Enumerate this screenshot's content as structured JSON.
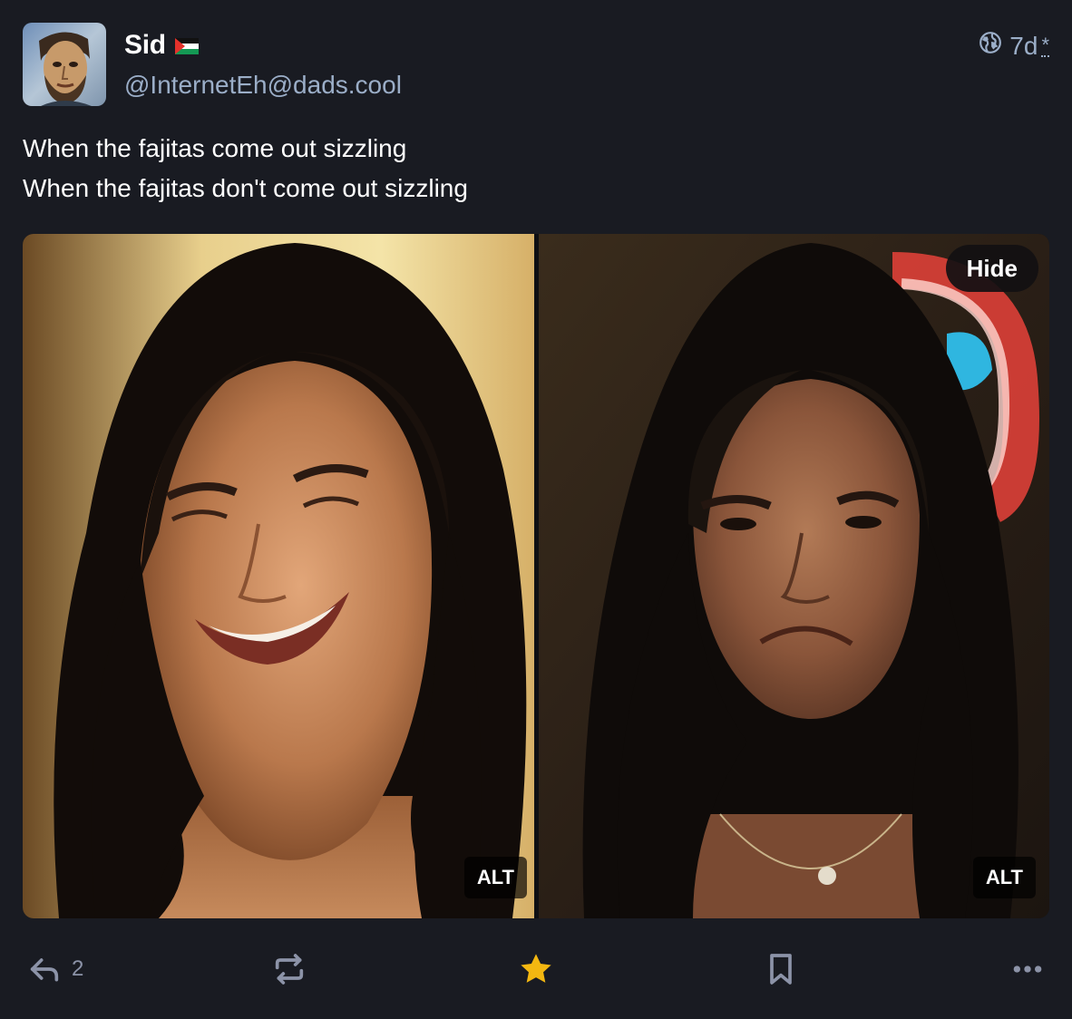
{
  "account": {
    "display_name": "Sid",
    "handle": "@InternetEh@dads.cool"
  },
  "post": {
    "timestamp": "7d",
    "edited_mark": "*",
    "lines": [
      "When the fajitas come out sizzling",
      "When the fajitas don't come out sizzling"
    ]
  },
  "media": {
    "alt_label_left": "ALT",
    "alt_label_right": "ALT",
    "hide_label": "Hide"
  },
  "actions": {
    "reply_count": "2"
  },
  "colors": {
    "background": "#191b22",
    "secondary_text": "#9baec8",
    "favourite_active": "#ca8f04",
    "icon_gray": "#8c93a8"
  },
  "icons": {
    "visibility": "globe-icon",
    "reply": "reply-icon",
    "boost": "boost-icon",
    "favourite": "star-icon",
    "bookmark": "bookmark-icon",
    "more": "more-icon",
    "flag": "flag-icon"
  }
}
